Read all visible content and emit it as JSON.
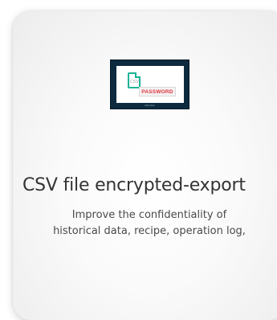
{
  "card": {
    "title": "CSV file encrypted-export",
    "description_lines": [
      "Improve the confidentiality of",
      "historical data, recipe, operation log,"
    ],
    "thumbnail": {
      "file_label": "CSV",
      "password_label": "PASSWORD",
      "brand_text": "Weintek"
    }
  }
}
